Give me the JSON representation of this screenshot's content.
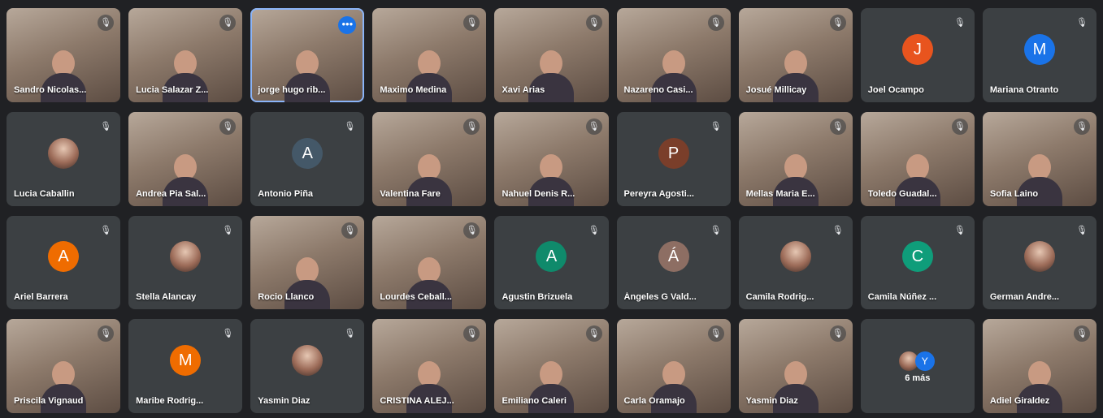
{
  "colors": {
    "background": "#202124",
    "tile": "#3c4043",
    "highlight": "#8ab4f8",
    "accent_blue": "#1a73e8"
  },
  "icons": {
    "mic_muted": "mic-off-icon",
    "options": "more-options-icon",
    "mic_glyph": "🎙",
    "dots_glyph": "•••"
  },
  "participants": [
    {
      "name": "Sandro Nicolas...",
      "kind": "video"
    },
    {
      "name": "Lucia Salazar Z...",
      "kind": "video"
    },
    {
      "name": "jorge hugo rib...",
      "kind": "video",
      "highlight": true
    },
    {
      "name": "Maximo Medina",
      "kind": "video"
    },
    {
      "name": "Xavi Arias",
      "kind": "video"
    },
    {
      "name": "Nazareno Casi...",
      "kind": "video"
    },
    {
      "name": "Josué Millicay",
      "kind": "video"
    },
    {
      "name": "Joel Ocampo",
      "kind": "avatar",
      "initial": "J",
      "color": "#e8541e"
    },
    {
      "name": "Mariana Otranto",
      "kind": "avatar",
      "initial": "M",
      "color": "#1a73e8"
    },
    {
      "name": "Lucia Caballin",
      "kind": "photo"
    },
    {
      "name": "Andrea Pia Sal...",
      "kind": "video"
    },
    {
      "name": "Antonio Piña",
      "kind": "avatar",
      "initial": "A",
      "color": "#445868"
    },
    {
      "name": "Valentina Fare",
      "kind": "video"
    },
    {
      "name": "Nahuel Denis R...",
      "kind": "video"
    },
    {
      "name": "Pereyra Agosti...",
      "kind": "avatar",
      "initial": "P",
      "color": "#7a3e2a"
    },
    {
      "name": "Mellas Maria E...",
      "kind": "video"
    },
    {
      "name": "Toledo Guadal...",
      "kind": "video"
    },
    {
      "name": "Sofia Laino",
      "kind": "video"
    },
    {
      "name": "Ariel Barrera",
      "kind": "avatar",
      "initial": "A",
      "color": "#ef6c00"
    },
    {
      "name": "Stella Alancay",
      "kind": "photo"
    },
    {
      "name": "Rocio Llanco",
      "kind": "video"
    },
    {
      "name": "Lourdes Ceball...",
      "kind": "video"
    },
    {
      "name": "Agustin Brizuela",
      "kind": "avatar",
      "initial": "A",
      "color": "#0f8a6b"
    },
    {
      "name": "Ángeles G Vald...",
      "kind": "avatar",
      "initial": "Á",
      "color": "#8d6e63"
    },
    {
      "name": "Camila Rodrig...",
      "kind": "photo"
    },
    {
      "name": "Camila Núñez ...",
      "kind": "avatar",
      "initial": "C",
      "color": "#0f9d7a"
    },
    {
      "name": "German Andre...",
      "kind": "photo"
    },
    {
      "name": "Priscila Vignaud",
      "kind": "video"
    },
    {
      "name": "Maribe Rodrig...",
      "kind": "avatar",
      "initial": "M",
      "color": "#ef6c00"
    },
    {
      "name": "Yasmin Diaz",
      "kind": "photo"
    },
    {
      "name": "CRISTINA ALEJ...",
      "kind": "video"
    },
    {
      "name": "Emiliano Caleri",
      "kind": "video"
    },
    {
      "name": "Carla Oramajo",
      "kind": "video"
    },
    {
      "name": "Yasmin Diaz",
      "kind": "video"
    },
    {
      "name": "6 más",
      "kind": "more",
      "initial": "Y"
    },
    {
      "name": "Adiel Giraldez",
      "kind": "video"
    }
  ]
}
